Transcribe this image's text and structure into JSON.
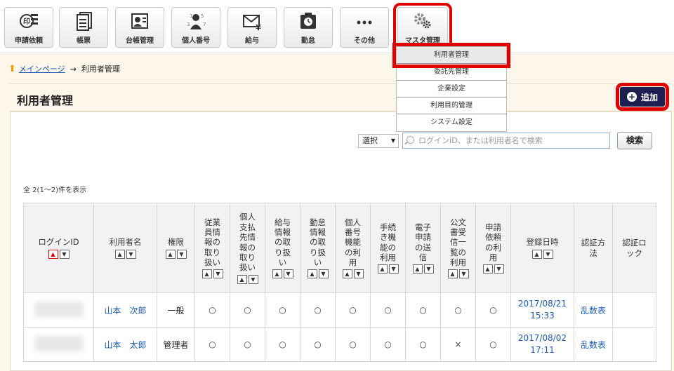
{
  "toolbar": {
    "items": [
      {
        "label": "申請依頼",
        "icon": "stamp-icon"
      },
      {
        "label": "帳票",
        "icon": "document-icon"
      },
      {
        "label": "台帳管理",
        "icon": "ledger-icon"
      },
      {
        "label": "個人番号",
        "icon": "person-number-icon"
      },
      {
        "label": "給与",
        "icon": "salary-envelope-icon"
      },
      {
        "label": "勤怠",
        "icon": "timecard-icon"
      },
      {
        "label": "その他",
        "icon": "more-dots-icon"
      },
      {
        "label": "マスタ管理",
        "icon": "gears-icon"
      }
    ],
    "icon_glyphs": {
      "stamp": "印",
      "number": "1 5 3 7",
      "yen": "¥",
      "dots": "•••"
    }
  },
  "dropdown": {
    "items": [
      "利用者管理",
      "委託先管理",
      "企業設定",
      "利用目的管理",
      "システム設定"
    ]
  },
  "breadcrumb": {
    "home": "メインページ",
    "arrow": "→",
    "current": "利用者管理"
  },
  "page": {
    "title": "利用者管理",
    "add_label": "追加"
  },
  "search": {
    "select_value": "選択",
    "placeholder": "ログインID、または利用者名で検索",
    "button_label": "検索"
  },
  "count_text": "全 2(1〜2)件を表示",
  "table": {
    "columns": [
      {
        "label": "ログインID",
        "sort": true
      },
      {
        "label": "利用者名",
        "sort": true
      },
      {
        "label": "権限",
        "sort": true
      },
      {
        "label": "従業員情報の取り扱い",
        "sort": true
      },
      {
        "label": "個人支払先情報の取り扱い",
        "sort": true
      },
      {
        "label": "給与情報の取り扱い",
        "sort": true
      },
      {
        "label": "勤怠情報の取り扱い",
        "sort": true
      },
      {
        "label": "個人番号機能の利用",
        "sort": true
      },
      {
        "label": "手続き機能の利用",
        "sort": true
      },
      {
        "label": "電子申請の送信",
        "sort": true
      },
      {
        "label": "公文書受信一覧の利用",
        "sort": true
      },
      {
        "label": "申請依頼の利用",
        "sort": true
      },
      {
        "label": "登録日時",
        "sort": true
      },
      {
        "label": "認証方法",
        "sort": false
      },
      {
        "label": "認証ロック",
        "sort": false
      }
    ],
    "rows": [
      {
        "login_id": "",
        "name": "山本　次郎",
        "role": "一般",
        "perms": [
          "○",
          "○",
          "○",
          "○",
          "○",
          "○",
          "○",
          "○",
          "○"
        ],
        "registered": "2017/08/21 15:33",
        "auth": "乱数表",
        "lock": ""
      },
      {
        "login_id": "",
        "name": "山本　太郎",
        "role": "管理者",
        "perms": [
          "○",
          "○",
          "○",
          "○",
          "○",
          "○",
          "○",
          "×",
          "○"
        ],
        "registered": "2017/08/02 17:11",
        "auth": "乱数表",
        "lock": ""
      }
    ]
  },
  "colors": {
    "accent": "#1e1e50",
    "highlight": "#e00000",
    "band": "#fdf6ea",
    "link": "#1a5bb4"
  }
}
